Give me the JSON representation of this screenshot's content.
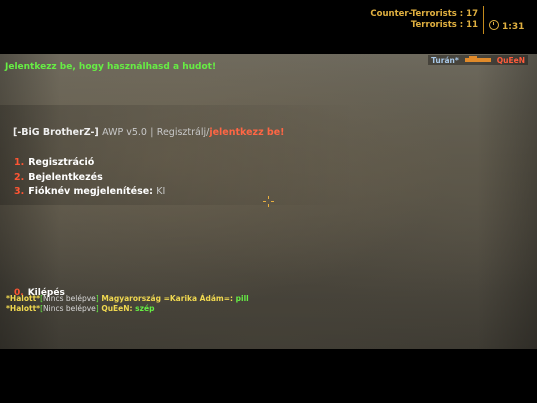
{
  "scoreboard": {
    "ct_label": "Counter-Terrorists :",
    "ct_score": "17",
    "t_label": "Terrorists :",
    "t_score": "11",
    "timer": "1:31"
  },
  "killfeed": {
    "killer": "Turán*",
    "weapon": "awp-icon",
    "victim": "QuEeN"
  },
  "hint": "Jelentkezz be, hogy használhasd a hudot!",
  "menu": {
    "clan": "[-BiG BrotherZ-]",
    "mod": "AWP v5.0",
    "separator": "|",
    "register_text": "Regisztrálj/",
    "login_text": "jelentkezz be!",
    "items": [
      {
        "num": "1.",
        "label": "Regisztráció",
        "value": ""
      },
      {
        "num": "2.",
        "label": "Bejelentkezés",
        "value": ""
      },
      {
        "num": "3.",
        "label": "Fióknév megjelenítése:",
        "value": "KI"
      }
    ],
    "exit": {
      "num": "0.",
      "label": "Kilépés"
    }
  },
  "chat": [
    {
      "prefix": "*Halott*",
      "lbr": "[",
      "tag": "Nincs belépve",
      "rbr": "]",
      "name": "Magyarország =Karika  Ádám=:",
      "message": "pill"
    },
    {
      "prefix": "*Halott*",
      "lbr": "[",
      "tag": "Nincs belépve",
      "rbr": "]",
      "name": "QuEeN:",
      "message": "szép"
    }
  ],
  "colors": {
    "hud_amber": "#e0b040",
    "hint_green": "#66ee44",
    "menu_number_red": "#ff5533"
  }
}
